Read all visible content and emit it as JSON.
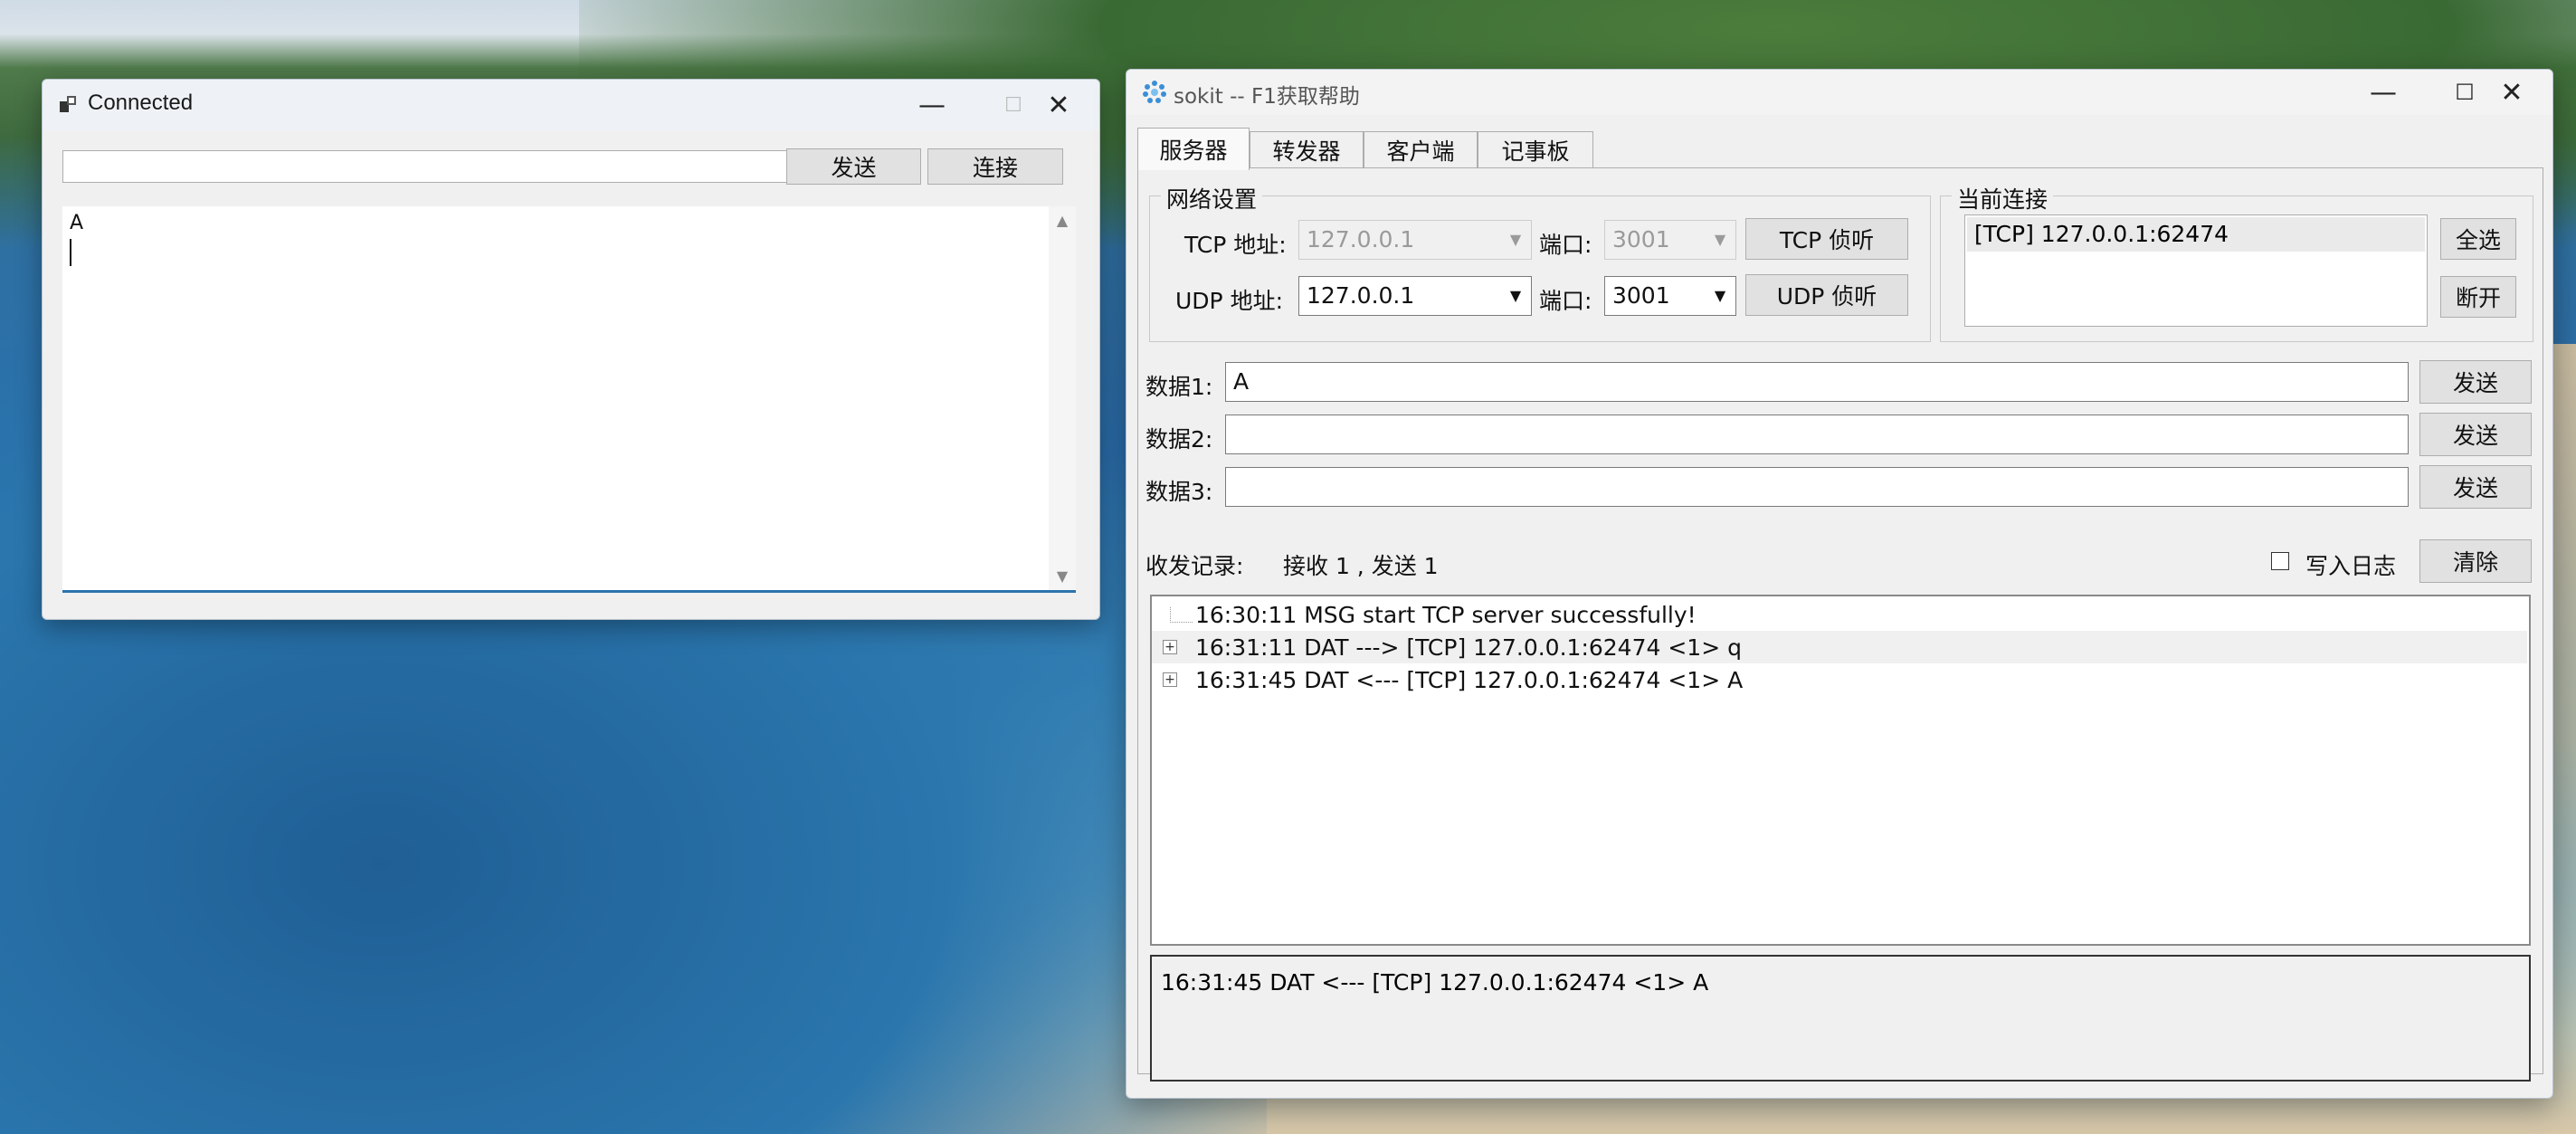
{
  "win1": {
    "title": "Connected",
    "url_value": "",
    "send_label": "发送",
    "connect_label": "连接",
    "content": "A"
  },
  "win2": {
    "title": "sokit -- F1获取帮助",
    "tabs": [
      {
        "label": "服务器",
        "active": true
      },
      {
        "label": "转发器"
      },
      {
        "label": "客户端"
      },
      {
        "label": "记事板"
      }
    ],
    "net": {
      "group_title": "网络设置",
      "tcp_label": "TCP 地址:",
      "tcp_addr": "127.0.0.1",
      "port_label": "端口:",
      "tcp_port": "3001",
      "tcp_listen": "TCP 侦听",
      "udp_label": "UDP 地址:",
      "udp_addr": "127.0.0.1",
      "udp_port": "3001",
      "udp_listen": "UDP 侦听"
    },
    "conn": {
      "group_title": "当前连接",
      "items": [
        "[TCP] 127.0.0.1:62474"
      ],
      "select_all": "全选",
      "disconnect": "断开"
    },
    "data": [
      {
        "label": "数据1:",
        "value": "A",
        "send": "发送"
      },
      {
        "label": "数据2:",
        "value": "",
        "send": "发送"
      },
      {
        "label": "数据3:",
        "value": "",
        "send": "发送"
      }
    ],
    "records": {
      "label": "收发记录:",
      "stats": "接收 1 , 发送 1",
      "write_log": "写入日志",
      "clear": "清除"
    },
    "log": [
      "16:30:11 MSG start TCP server successfully!",
      "16:31:11 DAT ---> [TCP] 127.0.0.1:62474 <1> q",
      "16:31:45 DAT <--- [TCP] 127.0.0.1:62474 <1> A"
    ],
    "detail": "16:31:45 DAT <--- [TCP] 127.0.0.1:62474 <1> A"
  }
}
